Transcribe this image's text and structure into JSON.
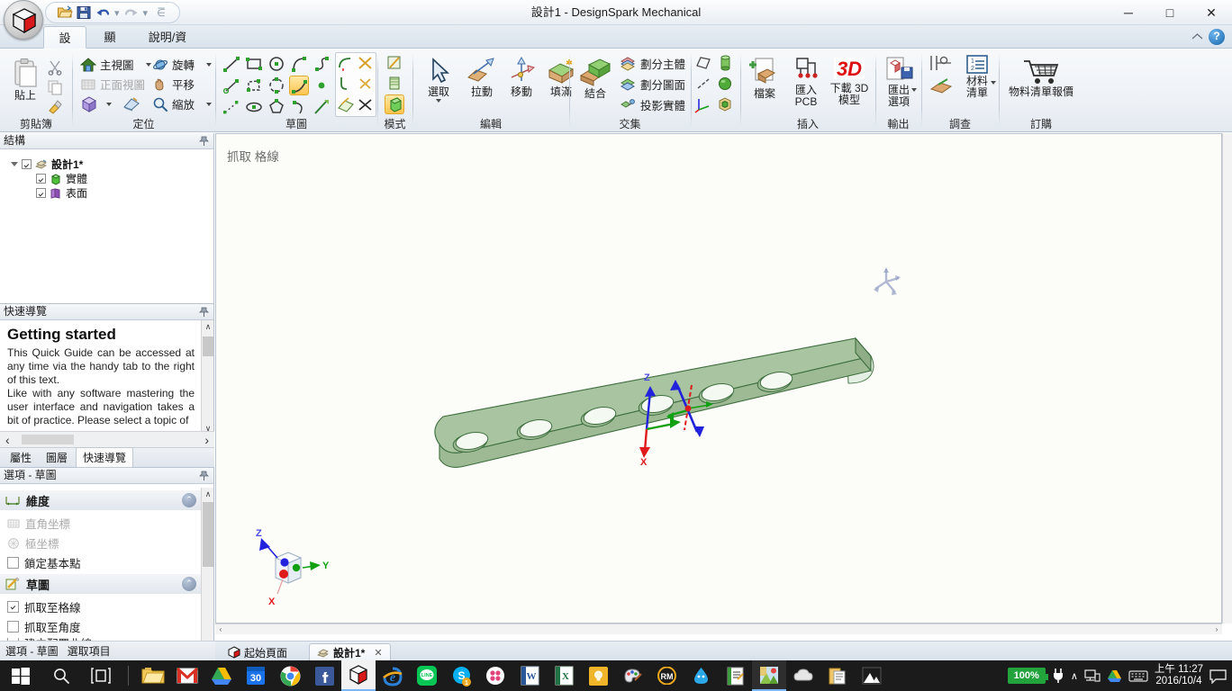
{
  "window": {
    "title": "設計1 - DesignSpark Mechanical",
    "minimize_label": "─",
    "maximize_label": "□",
    "close_label": "✕"
  },
  "quick_access": {
    "open_tooltip": "開啟",
    "save_tooltip": "儲存",
    "undo_tooltip": "復原",
    "redo_tooltip": "重做",
    "customize_tooltip": "自訂快速存取工具列"
  },
  "ribbon_tabs": [
    {
      "label": "設計",
      "active": true
    },
    {
      "label": "顯示",
      "active": false
    },
    {
      "label": "說明/資源",
      "active": false
    }
  ],
  "ribbon_groups": {
    "clipboard": {
      "label": "剪貼簿",
      "paste_label": "貼上",
      "cut_tooltip": "剪下",
      "copy_tooltip": "複製",
      "format_tooltip": "複製格式"
    },
    "orient": {
      "label": "定位",
      "items": [
        {
          "label": "主視圖",
          "icon": "home-icon",
          "has_caret": true,
          "disabled": false
        },
        {
          "label": "旋轉",
          "icon": "rotate-icon",
          "has_caret": true,
          "disabled": false
        },
        {
          "label": "正面視圖",
          "icon": "front-view-icon",
          "has_caret": false,
          "disabled": true
        },
        {
          "label": "平移",
          "icon": "pan-hand-icon",
          "has_caret": false,
          "disabled": false
        },
        {
          "label": "縮放",
          "icon": "zoom-icon",
          "has_caret": true,
          "disabled": false
        }
      ],
      "view_cube_tooltip": "視圖方向",
      "plane_tooltip": "設定平面"
    },
    "sketch": {
      "label": "草圖",
      "tools": [
        "line-icon",
        "rectangle-icon",
        "circle-icon",
        "arc-icon",
        "polyline-icon",
        "construction-line-icon",
        "polygon-icon",
        "three-point-arc-icon",
        "tangent-arc-icon",
        "point-icon",
        "spline-icon",
        "ellipse-icon",
        "polygon-inscribed-icon",
        "sweep-arc-icon",
        "cut-sketch-icon"
      ],
      "selected_tool": "tangent-arc-icon",
      "modify": [
        "trim-icon",
        "split-icon",
        "corner-icon",
        "project-icon",
        "offset-icon",
        "extend-icon"
      ]
    },
    "mode": {
      "label": "模式",
      "items": [
        "sketch-mode-icon",
        "section-mode-icon",
        "solid-mode-icon"
      ],
      "selected": "solid-mode-icon"
    },
    "edit": {
      "label": "編輯",
      "items": [
        {
          "label": "選取",
          "icon": "select-arrow-icon",
          "has_caret": true
        },
        {
          "label": "拉動",
          "icon": "pull-icon",
          "has_caret": false
        },
        {
          "label": "移動",
          "icon": "move-icon",
          "has_caret": false
        },
        {
          "label": "填滿",
          "icon": "fill-icon",
          "has_caret": false
        }
      ]
    },
    "intersect": {
      "label": "交集",
      "combine_label": "結合",
      "items": [
        {
          "label": "劃分主體",
          "icon": "split-body-icon"
        },
        {
          "label": "劃分圖面",
          "icon": "split-face-icon"
        },
        {
          "label": "投影實體",
          "icon": "project-solid-icon"
        }
      ]
    },
    "assembly": {
      "label": "",
      "icons": [
        "plane-icon",
        "cylinder-icon",
        "axis-icon",
        "sphere-icon",
        "origin-icon",
        "component-icon"
      ]
    },
    "insert": {
      "label": "插入",
      "items": [
        {
          "label": "檔案",
          "icon": "insert-file-icon",
          "lines": [
            "檔案"
          ]
        },
        {
          "label": "匯入 PCB",
          "icon": "import-pcb-icon",
          "lines": [
            "匯入",
            "PCB"
          ]
        },
        {
          "label": "下載 3D 模型",
          "icon": "download-3d-icon",
          "lines": [
            "下載 3D",
            "模型"
          ]
        }
      ]
    },
    "output": {
      "label": "輸出",
      "items": [
        {
          "label": "匯出選項",
          "icon": "export-icon",
          "lines": [
            "匯出",
            "選項"
          ],
          "has_caret": true
        }
      ]
    },
    "survey": {
      "label": "調查",
      "measure_tooltip": "測量",
      "mass_tooltip": "質量屬性",
      "bom_label_lines": [
        "材料",
        "清單"
      ],
      "bom_icon": "bom-list-icon"
    },
    "order": {
      "label": "訂購",
      "items": [
        {
          "label": "物料清單報價",
          "icon": "cart-icon"
        }
      ]
    }
  },
  "structure_panel": {
    "title": "結構",
    "pin_tooltip": "自動隱藏",
    "tree": [
      {
        "label": "設計1*",
        "icon": "design-icon",
        "checked": true,
        "level": 0,
        "bold": true
      },
      {
        "label": "實體",
        "icon": "solid-icon",
        "checked": true,
        "level": 1,
        "bold": false
      },
      {
        "label": "表面",
        "icon": "surface-icon",
        "checked": true,
        "level": 1,
        "bold": false
      }
    ]
  },
  "quick_guide_panel": {
    "title": "快速導覽",
    "heading": "Getting started",
    "paragraph1": "This Quick Guide can be accessed at any time via the handy tab to the right of this text.",
    "paragraph2": "Like with any software mastering the user interface and navigation takes a bit of practice. Please select a topic of",
    "prev_label": "‹",
    "next_label": "›",
    "scroll_up": "∧",
    "scroll_down": "∨",
    "tabs": [
      {
        "label": "屬性",
        "active": false
      },
      {
        "label": "圖層",
        "active": false
      },
      {
        "label": "快速導覽",
        "active": true
      }
    ]
  },
  "options_panel": {
    "title": "選項 - 草圖",
    "sections": [
      {
        "title": "維度",
        "icon": "dimension-icon",
        "collapse_label": "⌃",
        "rows": [
          {
            "label": "直角坐標",
            "icon": "cartesian-icon",
            "type": "icon",
            "disabled": true,
            "checked": false
          },
          {
            "label": "極坐標",
            "icon": "polar-icon",
            "type": "icon",
            "disabled": true,
            "checked": false
          },
          {
            "label": "鎖定基本點",
            "icon": "checkbox",
            "type": "checkbox",
            "disabled": false,
            "checked": false
          }
        ]
      },
      {
        "title": "草圖",
        "icon": "sketch-pencil-icon",
        "collapse_label": "⌃",
        "rows": [
          {
            "label": "抓取至格線",
            "icon": "checkbox",
            "type": "checkbox",
            "disabled": false,
            "checked": true
          },
          {
            "label": "抓取至角度",
            "icon": "checkbox",
            "type": "checkbox",
            "disabled": false,
            "checked": false
          },
          {
            "label": "建立配置曲線",
            "icon": "checkbox",
            "type": "checkbox",
            "disabled": false,
            "checked": false
          }
        ]
      }
    ],
    "tabs": [
      {
        "label": "選項 - 草圖",
        "active": true
      },
      {
        "label": "選取項目",
        "active": false
      }
    ]
  },
  "viewport": {
    "hint_text": "抓取 格線",
    "model_name": "perforated-plate",
    "model_hole_count": 6,
    "model_color": "#a8c4a0",
    "axis_labels": {
      "x": "X",
      "y": "Y",
      "z": "Z"
    },
    "axis_colors": {
      "x": "#e01b1b",
      "y": "#11a011",
      "z": "#2222dd"
    },
    "scroll_left": "‹",
    "scroll_right": "›"
  },
  "document_tabs": [
    {
      "label": "起始頁面",
      "icon": "cube-icon",
      "active": false,
      "closable": false
    },
    {
      "label": "設計1*",
      "icon": "design-doc-icon",
      "active": true,
      "closable": true,
      "close_label": "✕"
    }
  ],
  "status_bar": {
    "left": "選項 - 草圖",
    "right": "選取項目"
  },
  "taskbar": {
    "start_tooltip": "開始",
    "search_tooltip": "搜尋",
    "taskview_tooltip": "工作檢視",
    "apps": [
      {
        "name": "file-explorer-icon",
        "label": "檔案總管"
      },
      {
        "name": "gmail-icon",
        "label": "Gmail"
      },
      {
        "name": "google-drive-icon",
        "label": "Google Drive"
      },
      {
        "name": "calendar-icon",
        "label": "行事曆",
        "badge": "30"
      },
      {
        "name": "chrome-icon",
        "label": "Google Chrome"
      },
      {
        "name": "facebook-icon",
        "label": "Facebook"
      },
      {
        "name": "designspark-icon",
        "label": "DesignSpark Mechanical",
        "active": true
      },
      {
        "name": "internet-explorer-icon",
        "label": "Internet Explorer"
      },
      {
        "name": "line-icon",
        "label": "LINE"
      },
      {
        "name": "skype-icon",
        "label": "Skype",
        "badge": "1"
      },
      {
        "name": "bonjour-icon",
        "label": "應用程式"
      },
      {
        "name": "word-icon",
        "label": "Microsoft Word"
      },
      {
        "name": "excel-icon",
        "label": "Microsoft Excel"
      },
      {
        "name": "notes-icon",
        "label": "便條"
      },
      {
        "name": "paint-icon",
        "label": "小畫家"
      },
      {
        "name": "rm-icon",
        "label": "RM"
      },
      {
        "name": "droplet-icon",
        "label": "應用程式"
      },
      {
        "name": "reader-icon",
        "label": "閱讀器"
      },
      {
        "name": "photos-icon",
        "label": "相片",
        "active": true
      },
      {
        "name": "cloud-icon",
        "label": "雲端"
      },
      {
        "name": "clipboard-icon",
        "label": "剪貼簿"
      },
      {
        "name": "gallery-icon",
        "label": "圖片"
      }
    ],
    "tray": {
      "battery_percent": "100%",
      "power_tooltip": "電源",
      "show_hidden": "∧",
      "network_tooltip": "網路",
      "drive_tooltip": "Google Drive",
      "keyboard_tooltip": "觸控鍵盤",
      "time": "上午 11:27",
      "date": "2016/10/4",
      "notifications_tooltip": "通知"
    }
  }
}
